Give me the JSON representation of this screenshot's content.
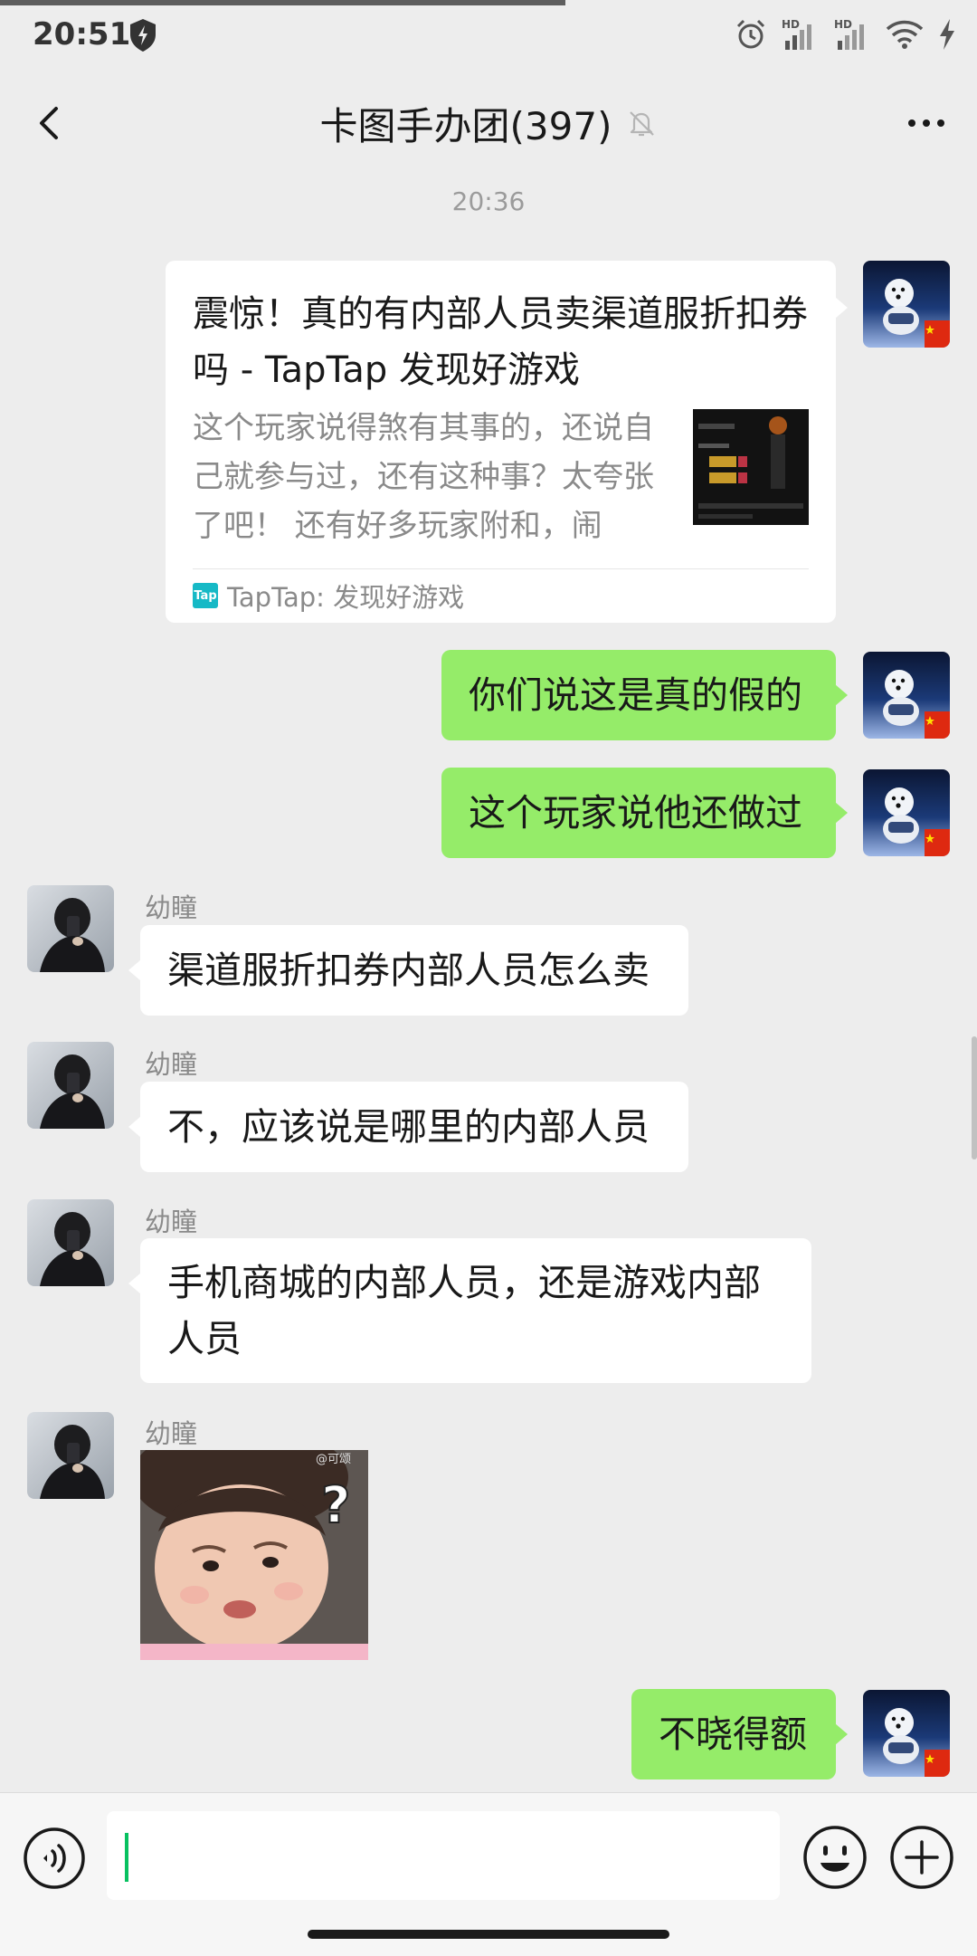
{
  "status_bar": {
    "time": "20:51",
    "network_1": "HD",
    "network_2": "HD"
  },
  "header": {
    "title": "卡图手办团(397)",
    "back_icon": "chevron-left-icon",
    "mute_icon": "bell-off-icon",
    "more_icon": "more-icon"
  },
  "chat": {
    "timestamp": "20:36",
    "link_card": {
      "title": "震惊！真的有内部人员卖渠道服折扣券吗 - TapTap 发现好游戏",
      "description": "这个玩家说得煞有其事的，还说自己就参与过，还有这种事？太夸张了吧！ 还有好多玩家附和，闹得…",
      "source_logo": "Tap",
      "source": "TapTap: 发现好游戏"
    },
    "messages": [
      {
        "side": "self",
        "text": "你们说这是真的假的"
      },
      {
        "side": "self",
        "text": "这个玩家说他还做过"
      },
      {
        "side": "other",
        "sender": "幼瞳",
        "text": "渠道服折扣券内部人员怎么卖"
      },
      {
        "side": "other",
        "sender": "幼瞳",
        "text": "不，应该说是哪里的内部人员"
      },
      {
        "side": "other",
        "sender": "幼瞳",
        "text": "手机商城的内部人员，还是游戏内部人员"
      },
      {
        "side": "other",
        "sender": "幼瞳",
        "sticker_watermark": "@可颂"
      },
      {
        "side": "self",
        "text": "不晓得额"
      }
    ]
  },
  "input_bar": {
    "voice_icon": "voice-icon",
    "input_value": "",
    "emoji_icon": "emoji-icon",
    "plus_icon": "plus-icon"
  },
  "colors": {
    "background": "#ededed",
    "self_bubble": "#95ec69",
    "other_bubble": "#ffffff",
    "accent_caret": "#07c160"
  }
}
